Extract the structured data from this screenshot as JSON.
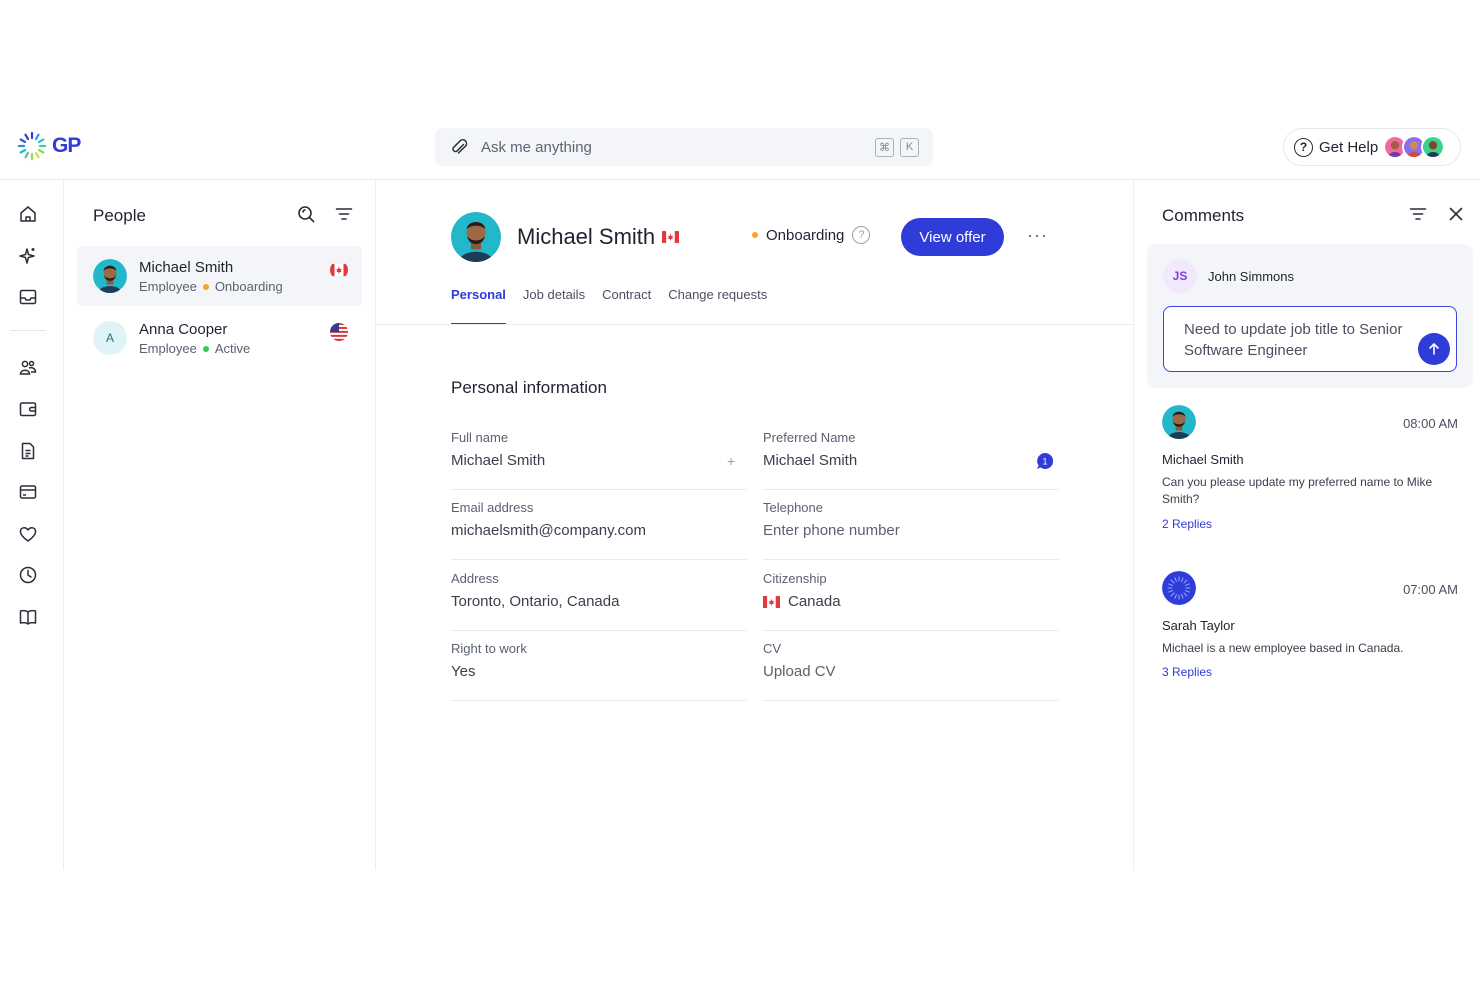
{
  "app": {
    "logo_text": "GP"
  },
  "search": {
    "placeholder": "Ask me anything",
    "shortcut_keys": [
      "⌘",
      "K"
    ]
  },
  "help": {
    "label": "Get Help"
  },
  "rail": {
    "icons": [
      "home-icon",
      "sparkle-icon",
      "inbox-icon",
      "people-icon",
      "wallet-icon",
      "document-icon",
      "card-icon",
      "heart-icon",
      "clock-icon",
      "book-icon"
    ]
  },
  "people": {
    "title": "People",
    "items": [
      {
        "name": "Michael Smith",
        "role": "Employee",
        "status": "Onboarding",
        "status_color": "#f5a623",
        "flag": "canada"
      },
      {
        "name": "Anna Cooper",
        "role": "Employee",
        "status": "Active",
        "status_color": "#34c759",
        "initial": "A",
        "flag": "usa"
      }
    ]
  },
  "profile": {
    "name": "Michael Smith",
    "status": "Onboarding",
    "status_color": "#f5a623",
    "offer_button": "View offer",
    "more": "···",
    "tabs": [
      "Personal",
      "Job details",
      "Contract",
      "Change requests"
    ],
    "active_tab": "Personal",
    "section_title": "Personal information",
    "fields": {
      "full_name": {
        "label": "Full name",
        "value": "Michael Smith"
      },
      "preferred_name": {
        "label": "Preferred Name",
        "value": "Michael Smith",
        "comment_count": "1"
      },
      "email": {
        "label": "Email address",
        "value": "michaelsmith@company.com"
      },
      "telephone": {
        "label": "Telephone",
        "value": "Enter phone number"
      },
      "address": {
        "label": "Address",
        "value": "Toronto, Ontario, Canada"
      },
      "citizenship": {
        "label": "Citizenship",
        "value": "Canada"
      },
      "right_to_work": {
        "label": "Right to work",
        "value": "Yes"
      },
      "cv": {
        "label": "CV",
        "value": "Upload CV"
      }
    }
  },
  "comments": {
    "title": "Comments",
    "composer": {
      "initials": "JS",
      "name": "John Simmons",
      "text": "Need to update job title to Senior Software Engineer"
    },
    "items": [
      {
        "author": "Michael Smith",
        "time": "08:00 AM",
        "text": "Can you please update my preferred name to Mike Smith?",
        "replies": "2 Replies"
      },
      {
        "author": "Sarah Taylor",
        "time": "07:00 AM",
        "text": "Michael is a new employee based in Canada.",
        "replies": "3 Replies"
      }
    ]
  },
  "colors": {
    "accent": "#2f3cd8",
    "onboarding": "#f5a623",
    "active": "#34c759",
    "canada_red": "#e03a3e"
  }
}
